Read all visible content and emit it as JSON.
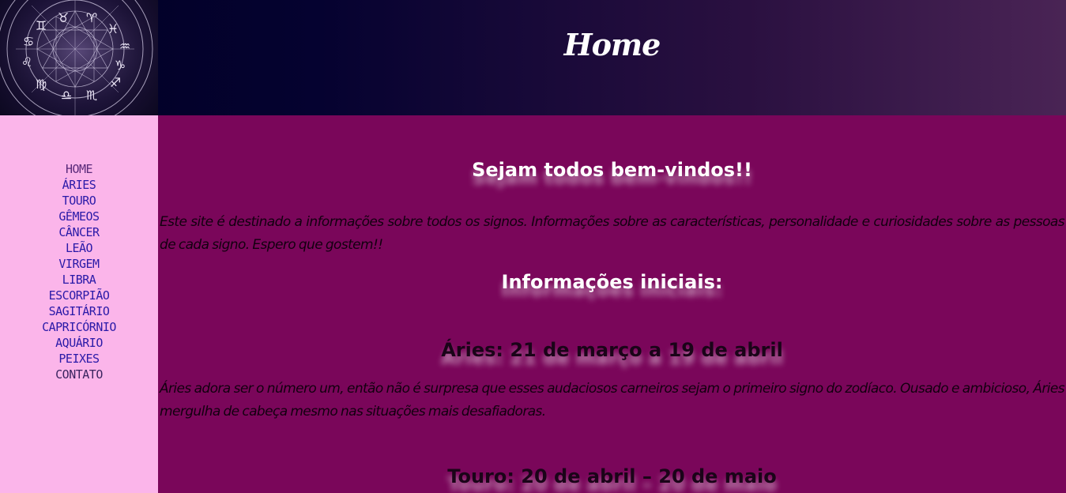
{
  "header": {
    "title": "Home"
  },
  "sidebar": {
    "items": [
      {
        "label": "HOME"
      },
      {
        "label": "ÁRIES"
      },
      {
        "label": "TOURO"
      },
      {
        "label": "GÊMEOS"
      },
      {
        "label": "CÂNCER"
      },
      {
        "label": "LEÃO"
      },
      {
        "label": "VIRGEM"
      },
      {
        "label": "LIBRA"
      },
      {
        "label": "ESCORPIÃO"
      },
      {
        "label": "SAGITÁRIO"
      },
      {
        "label": "CAPRICÓRNIO"
      },
      {
        "label": "AQUÁRIO"
      },
      {
        "label": "PEIXES"
      },
      {
        "label": "CONTATO"
      }
    ]
  },
  "main": {
    "welcome_heading": "Sejam todos bem-vindos!!",
    "intro_text": "Este site é destinado a informações sobre todos os signos. Informações sobre as características, personalidade e curiosidades sobre as pessoas de cada signo. Espero que gostem!!",
    "info_heading": "Informações iniciais:",
    "signs": [
      {
        "heading": "Áries: 21 de março a 19 de abril",
        "text": "Áries adora ser o número um, então não é surpresa que esses audaciosos carneiros sejam o primeiro signo do zodíaco. Ousado e ambicioso, Áries mergulha de cabeça mesmo nas situações mais desafiadoras."
      },
      {
        "heading": "Touro: 20 de abril – 20 de maio"
      }
    ]
  },
  "colors": {
    "main_bg": "#7a065a",
    "sidebar_bg": "#fbb5ea",
    "nav_link": "#2a1aa8",
    "header_dark": "#000024"
  },
  "icons": {
    "logo": "zodiac-wheel-icon"
  }
}
